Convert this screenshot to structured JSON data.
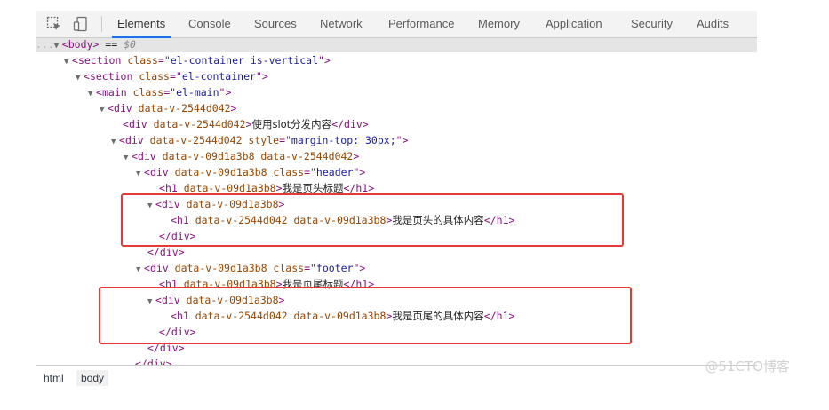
{
  "tabs": [
    "Elements",
    "Console",
    "Sources",
    "Network",
    "Performance",
    "Memory",
    "Application",
    "Security",
    "Audits"
  ],
  "dom": {
    "l0": {
      "prefix": "...",
      "tag": "body",
      "eq": " == ",
      "var": "$0"
    },
    "l1": {
      "tag": "section",
      "attr": "class",
      "val": "el-container is-vertical"
    },
    "l2": {
      "tag": "section",
      "attr": "class",
      "val": "el-container"
    },
    "l3": {
      "tag": "main",
      "attr": "class",
      "val": "el-main"
    },
    "l4": {
      "tag": "div",
      "attr": "data-v-2544d042"
    },
    "l5": {
      "tag": "div",
      "attr": "data-v-2544d042",
      "text": "使用slot分发内容",
      "close": "</div>"
    },
    "l6": {
      "tag": "div",
      "attr": "data-v-2544d042 style",
      "val": "margin-top: 30px;"
    },
    "l7": {
      "tag": "div",
      "attr": "data-v-09d1a3b8 data-v-2544d042"
    },
    "l8": {
      "tag": "div",
      "attr": "data-v-09d1a3b8 class",
      "val": "header"
    },
    "l9": {
      "tag": "h1",
      "attr": "data-v-09d1a3b8",
      "text": "我是页头标题",
      "close": "</h1>"
    },
    "l10": {
      "tag": "div",
      "attr": "data-v-09d1a3b8"
    },
    "l11": {
      "tag": "h1",
      "attr": "data-v-2544d042 data-v-09d1a3b8",
      "text": "我是页头的具体内容",
      "close": "</h1>"
    },
    "l12": {
      "close": "</div>"
    },
    "l13": {
      "close": "</div>"
    },
    "l14": {
      "tag": "div",
      "attr": "data-v-09d1a3b8 class",
      "val": "footer"
    },
    "l15": {
      "tag": "h1",
      "attr": "data-v-09d1a3b8",
      "text": "我是页尾标题",
      "close": "</h1>"
    },
    "l16": {
      "tag": "div",
      "attr": "data-v-09d1a3b8"
    },
    "l17": {
      "tag": "h1",
      "attr": "data-v-2544d042 data-v-09d1a3b8",
      "text": "我是页尾的具体内容",
      "close": "</h1>"
    },
    "l18": {
      "close": "</div>"
    },
    "l19": {
      "close": "</div>"
    },
    "l20": {
      "close": "</div>"
    }
  },
  "breadcrumbs": [
    "html",
    "body"
  ],
  "watermark": "@51CTO博客",
  "colors": {
    "highlight_box": "#e53935",
    "tag": "#881280",
    "attr_name": "#994500",
    "attr_value": "#1a1aa6"
  }
}
